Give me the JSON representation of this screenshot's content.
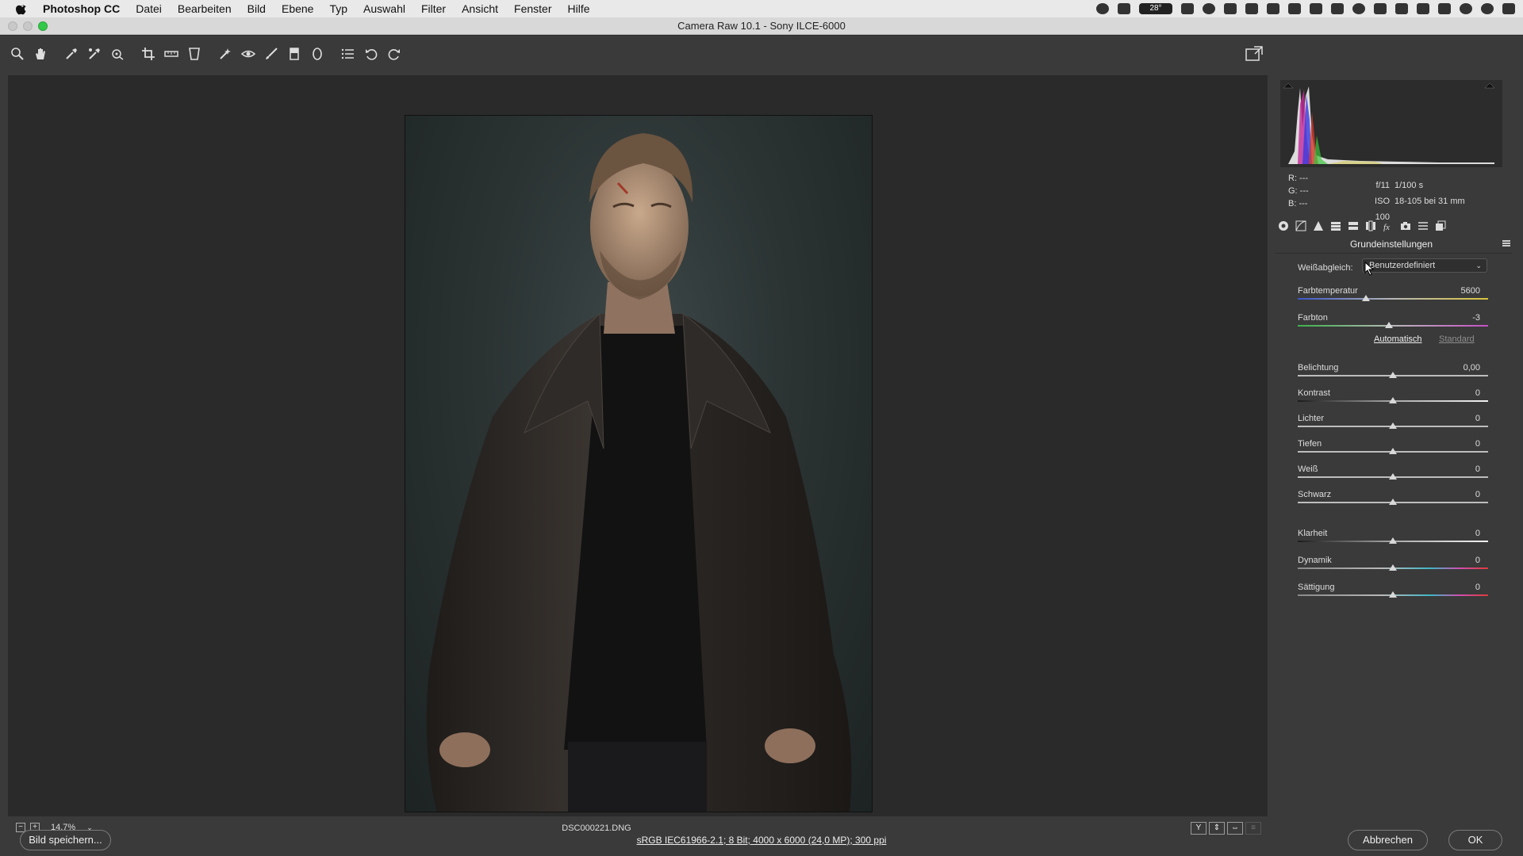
{
  "menubar": {
    "app_name": "Photoshop CC",
    "items": [
      "Datei",
      "Bearbeiten",
      "Bild",
      "Ebene",
      "Typ",
      "Auswahl",
      "Filter",
      "Ansicht",
      "Fenster",
      "Hilfe"
    ],
    "status_badge": "28°"
  },
  "window": {
    "title": "Camera Raw 10.1 - Sony ILCE-6000"
  },
  "toolbar": {
    "tools": [
      "zoom-icon",
      "hand-icon",
      "white-balance-icon",
      "color-sampler-icon",
      "targeted-adjust-icon",
      "crop-icon",
      "straighten-icon",
      "transform-icon",
      "spot-removal-icon",
      "red-eye-icon",
      "adjustment-brush-icon",
      "graduated-filter-icon",
      "radial-filter-icon",
      "preferences-icon",
      "rotate-left-icon",
      "rotate-right-icon"
    ]
  },
  "status": {
    "zoom": "14,7%",
    "filename": "DSC000221.DNG",
    "view_modes": [
      "Y",
      "⇕",
      "⇔",
      "≡"
    ]
  },
  "footer": {
    "save_label": "Bild speichern...",
    "workflow": "sRGB IEC61966-2.1; 8 Bit; 4000 x 6000 (24,0 MP); 300 ppi",
    "cancel_label": "Abbrechen",
    "ok_label": "OK"
  },
  "rgb": {
    "r": "R:  ---",
    "g": "G:  ---",
    "b": "B:  ---"
  },
  "exif": {
    "aperture": "f/11",
    "shutter": "1/100 s",
    "iso": "ISO 100",
    "lens": "18-105 bei 31 mm"
  },
  "panel": {
    "title": "Grundeinstellungen",
    "wb_label": "Weißabgleich:",
    "wb_value": "Benutzerdefiniert",
    "auto_label": "Automatisch",
    "standard_label": "Standard",
    "sliders": {
      "temperature": {
        "name": "Farbtemperatur",
        "value": "5600",
        "position": 0.36
      },
      "tint": {
        "name": "Farbton",
        "value": "-3",
        "position": 0.48
      },
      "exposure": {
        "name": "Belichtung",
        "value": "0,00",
        "position": 0.5
      },
      "contrast": {
        "name": "Kontrast",
        "value": "0",
        "position": 0.5
      },
      "highlights": {
        "name": "Lichter",
        "value": "0",
        "position": 0.5
      },
      "shadows": {
        "name": "Tiefen",
        "value": "0",
        "position": 0.5
      },
      "whites": {
        "name": "Weiß",
        "value": "0",
        "position": 0.5
      },
      "blacks": {
        "name": "Schwarz",
        "value": "0",
        "position": 0.5
      },
      "clarity": {
        "name": "Klarheit",
        "value": "0",
        "position": 0.5
      },
      "vibrance": {
        "name": "Dynamik",
        "value": "0",
        "position": 0.5
      },
      "saturation": {
        "name": "Sättigung",
        "value": "0",
        "position": 0.5
      }
    }
  }
}
